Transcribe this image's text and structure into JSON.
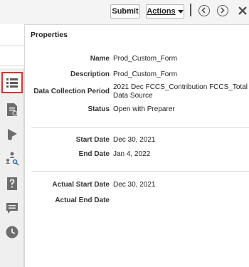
{
  "toolbar": {
    "submit_label": "Submit",
    "actions_label": "Actions"
  },
  "panel": {
    "title": "Properties",
    "fields": [
      {
        "label": "Name",
        "value": "Prod_Custom_Form"
      },
      {
        "label": "Description",
        "value": "Prod_Custom_Form"
      },
      {
        "label": "Data Collection Period",
        "value": "2021 Dec FCCS_Contribution FCCS_Total",
        "value2": "Data Source"
      },
      {
        "label": "Status",
        "value": "Open with Preparer"
      },
      {
        "label": "Start Date",
        "value": "Dec 30, 2021"
      },
      {
        "label": "End Date",
        "value": "Jan 4, 2022"
      },
      {
        "label": "Actual Start Date",
        "value": "Dec 30, 2021"
      },
      {
        "label": "Actual End Date",
        "value": ""
      }
    ]
  },
  "rail_icons": [
    "properties-list-icon",
    "document-details-icon",
    "alerts-icon",
    "workflow-users-icon",
    "questions-icon",
    "comments-icon",
    "history-clock-icon"
  ],
  "colors": {
    "selection_border": "#e03030",
    "icon_gray": "#6d6d6d"
  }
}
